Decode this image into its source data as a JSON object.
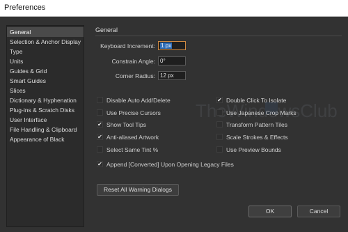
{
  "window": {
    "title": "Preferences"
  },
  "sidebar": {
    "items": [
      {
        "label": "General",
        "active": true
      },
      {
        "label": "Selection & Anchor Display"
      },
      {
        "label": "Type"
      },
      {
        "label": "Units"
      },
      {
        "label": "Guides & Grid"
      },
      {
        "label": "Smart Guides"
      },
      {
        "label": "Slices"
      },
      {
        "label": "Dictionary & Hyphenation"
      },
      {
        "label": "Plug-ins & Scratch Disks"
      },
      {
        "label": "User Interface"
      },
      {
        "label": "File Handling & Clipboard"
      },
      {
        "label": "Appearance of Black"
      }
    ]
  },
  "general": {
    "title": "General",
    "keyboard_increment": {
      "label": "Keyboard Increment:",
      "value": "1 px"
    },
    "constrain_angle": {
      "label": "Constrain Angle:",
      "value": "0°"
    },
    "corner_radius": {
      "label": "Corner Radius:",
      "value": "12 px"
    },
    "options_left": [
      {
        "label": "Disable Auto Add/Delete",
        "checked": false
      },
      {
        "label": "Use Precise Cursors",
        "checked": false
      },
      {
        "label": "Show Tool Tips",
        "checked": true
      },
      {
        "label": "Anti-aliased Artwork",
        "checked": true
      },
      {
        "label": "Select Same Tint %",
        "checked": false
      }
    ],
    "options_right": [
      {
        "label": "Double Click To Isolate",
        "checked": true
      },
      {
        "label": "Use Japanese Crop Marks",
        "checked": false
      },
      {
        "label": "Transform Pattern Tiles",
        "checked": false
      },
      {
        "label": "Scale Strokes & Effects",
        "checked": false
      },
      {
        "label": "Use Preview Bounds",
        "checked": false
      }
    ],
    "append_option": {
      "label": "Append [Converted] Upon Opening Legacy Files",
      "checked": true
    },
    "reset_button": "Reset All Warning Dialogs"
  },
  "footer": {
    "ok": "OK",
    "cancel": "Cancel"
  },
  "watermark": {
    "text": "TheWindowsClub"
  },
  "check_glyph": "✔"
}
